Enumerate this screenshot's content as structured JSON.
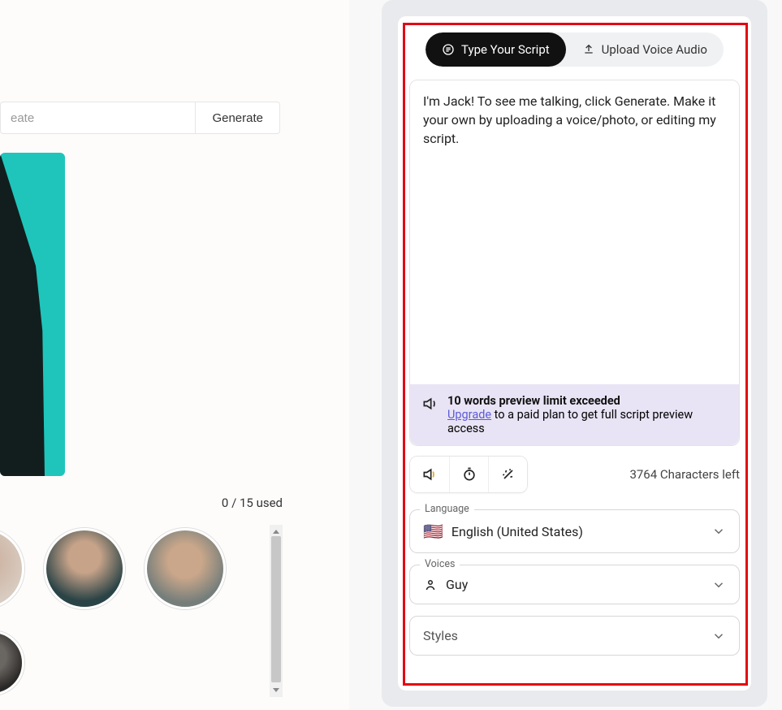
{
  "left": {
    "input_partial": "eate",
    "generate_label": "Generate",
    "usage_text": "0 / 15 used"
  },
  "right": {
    "tabs": {
      "type_script": "Type Your Script",
      "upload_voice": "Upload Voice Audio"
    },
    "script_text": "I'm Jack! To see me talking, click Generate. Make it your own by uploading a voice/photo, or editing my script.",
    "warn_title": "10 words preview limit exceeded",
    "warn_link": "Upgrade",
    "warn_rest": " to a paid plan to get full script preview access",
    "chars_left": "3764 Characters left",
    "language_label": "Language",
    "language_value": "English (United States)",
    "voices_label": "Voices",
    "voices_value": "Guy",
    "styles_label": "Styles"
  }
}
